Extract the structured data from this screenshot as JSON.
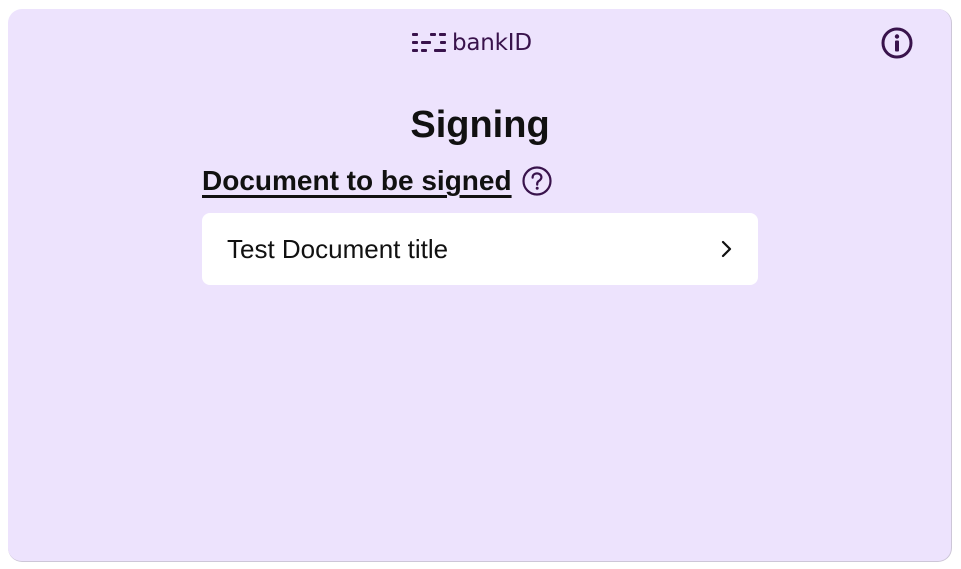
{
  "header": {
    "logo_text": "bankID",
    "info_icon": "info-circle-icon"
  },
  "main": {
    "title": "Signing",
    "section_heading": "Document to be signed",
    "help_icon": "question-circle-icon",
    "documents": [
      {
        "title": "Test Document title",
        "icon": "chevron-right-icon"
      }
    ]
  },
  "colors": {
    "card_background": "#ede3fd",
    "brand_purple": "#39134c",
    "text": "#111111",
    "row_background": "#ffffff"
  }
}
